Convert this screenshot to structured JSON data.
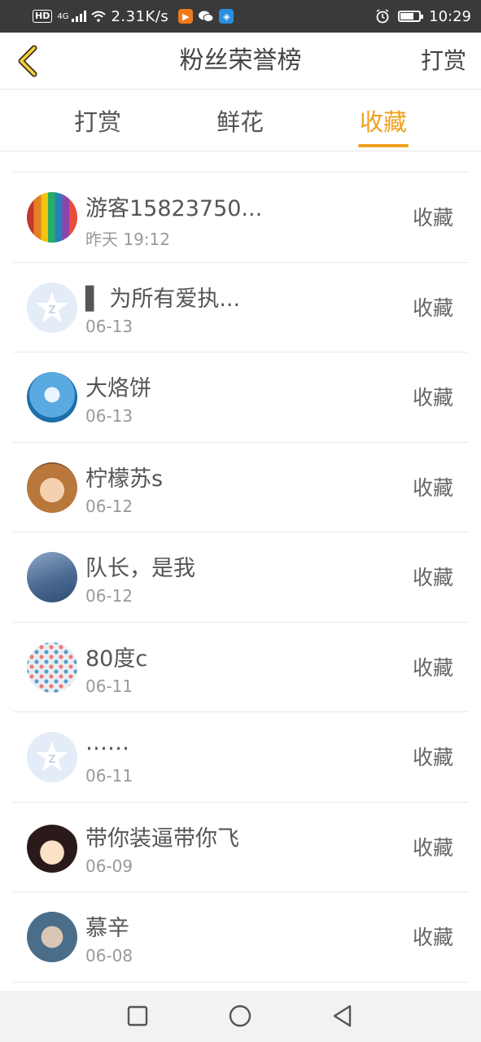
{
  "status_bar": {
    "hd": "HD",
    "network": "4G",
    "speed": "2.31K/s",
    "time": "10:29"
  },
  "header": {
    "title": "粉丝荣誉榜",
    "action": "打赏",
    "back_icon": "chevron-left-icon",
    "accent_color": "#f0a020"
  },
  "tabs": [
    {
      "label": "打赏",
      "active": false
    },
    {
      "label": "鲜花",
      "active": false
    },
    {
      "label": "收藏",
      "active": true
    }
  ],
  "list": {
    "items": [
      {
        "name": "游客15823750...",
        "time": "昨天 19:12",
        "action": "收藏"
      },
      {
        "name": "▌ 为所有爱执...",
        "time": "06-13",
        "action": "收藏"
      },
      {
        "name": "大烙饼",
        "time": "06-13",
        "action": "收藏"
      },
      {
        "name": "柠檬苏s",
        "time": "06-12",
        "action": "收藏"
      },
      {
        "name": "队长，是我",
        "time": "06-12",
        "action": "收藏"
      },
      {
        "name": "80度c",
        "time": "06-11",
        "action": "收藏"
      },
      {
        "name": "……",
        "time": "06-11",
        "action": "收藏"
      },
      {
        "name": "带你装逼带你飞",
        "time": "06-09",
        "action": "收藏"
      },
      {
        "name": "慕辛",
        "time": "06-08",
        "action": "收藏"
      }
    ]
  },
  "navbar": {
    "icons": [
      "square-recent-icon",
      "circle-home-icon",
      "triangle-back-icon"
    ]
  }
}
